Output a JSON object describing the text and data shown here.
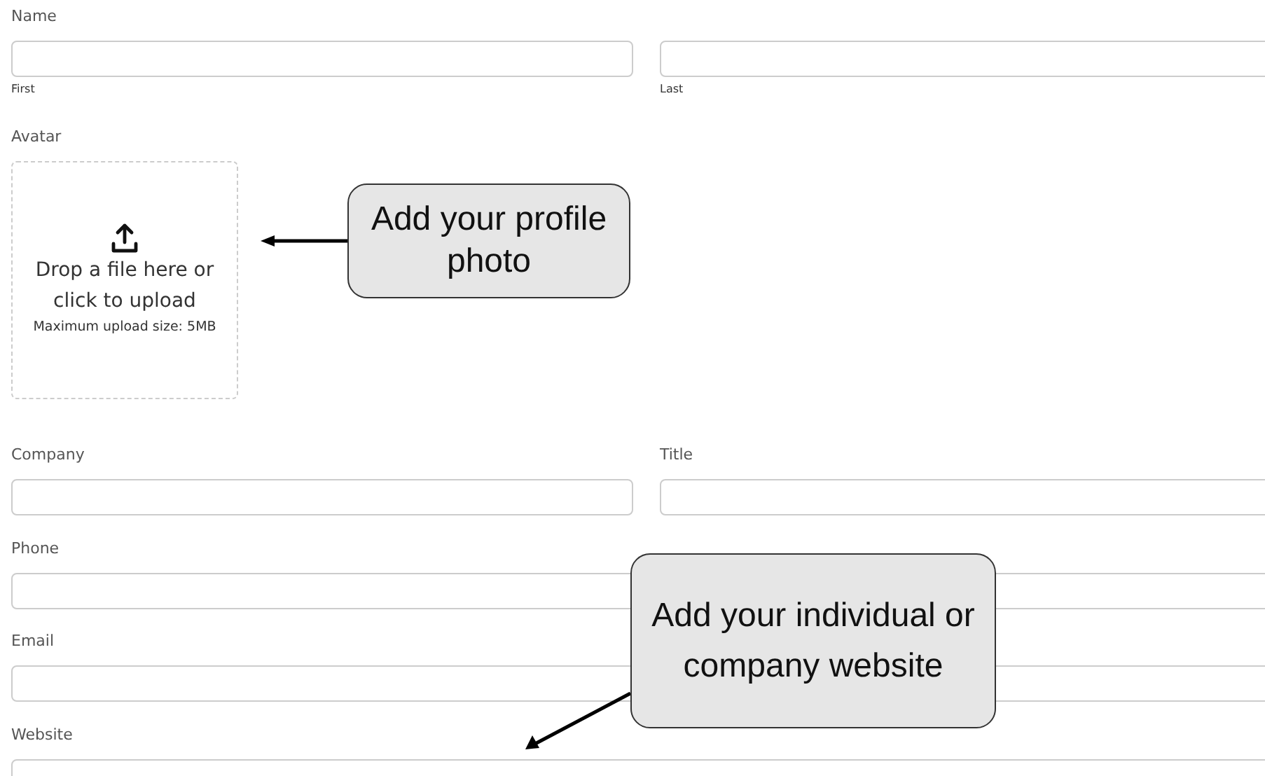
{
  "name": {
    "label": "Name",
    "first": "First",
    "last": "Last"
  },
  "avatar": {
    "label": "Avatar",
    "drop_text": "Drop a file here or click to upload",
    "limit": "Maximum upload size: 5MB"
  },
  "company": {
    "label": "Company"
  },
  "title": {
    "label": "Title"
  },
  "phone": {
    "label": "Phone"
  },
  "email": {
    "label": "Email"
  },
  "website": {
    "label": "Website"
  },
  "callouts": [
    {
      "text": "Add your profile photo"
    },
    {
      "text": "Add your individual or company website"
    }
  ]
}
